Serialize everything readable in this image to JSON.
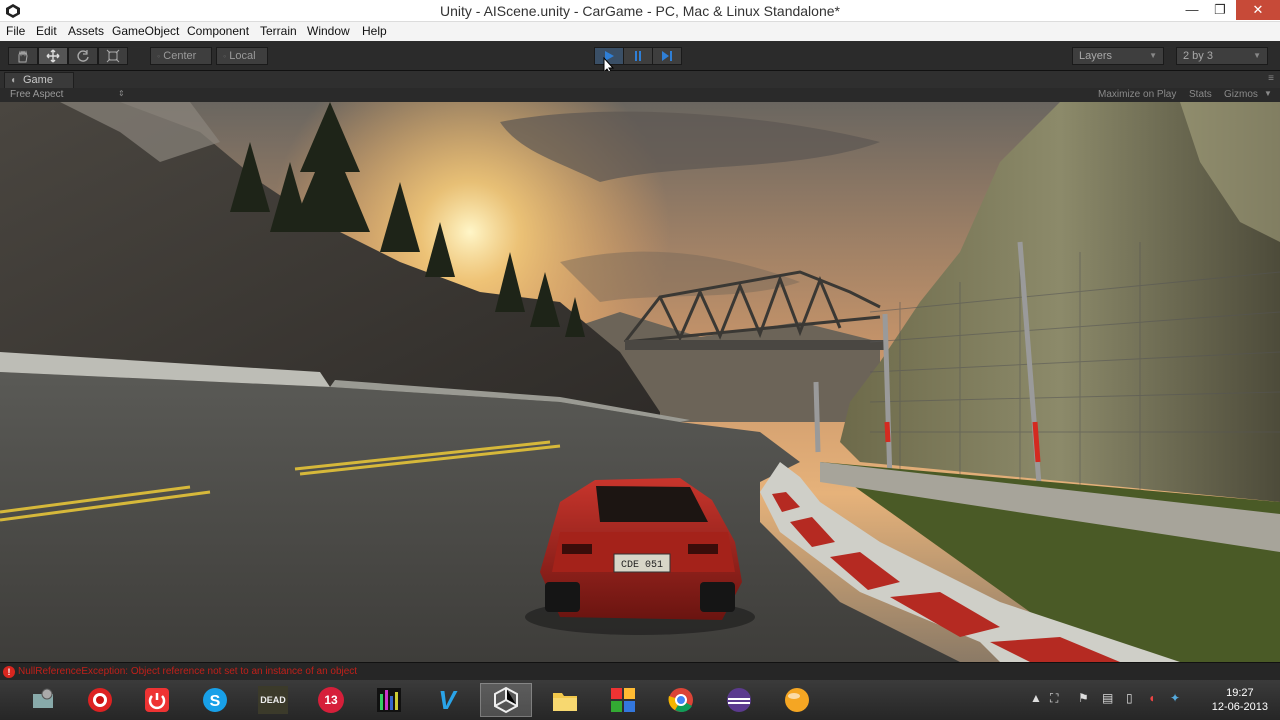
{
  "window": {
    "title": "Unity - AIScene.unity - CarGame - PC, Mac & Linux Standalone*",
    "min_label": "—",
    "max_label": "❐",
    "close_label": "✕"
  },
  "menu": [
    "File",
    "Edit",
    "Assets",
    "GameObject",
    "Component",
    "Terrain",
    "Window",
    "Help"
  ],
  "toolbar": {
    "pivot_center": "Center",
    "pivot_local": "Local",
    "layers": "Layers",
    "layout": "2 by 3"
  },
  "game": {
    "tab_label": "Game",
    "aspect": "Free Aspect",
    "maximize": "Maximize on Play",
    "stats": "Stats",
    "gizmos": "Gizmos",
    "plate": "CDE 051"
  },
  "console": {
    "error_icon": "!",
    "error": "NullReferenceException: Object reference not set to an instance of an object"
  },
  "taskbar": {
    "time": "19:27",
    "date": "12-06-2013",
    "game_badge": "DEAD",
    "num_badge": "13",
    "v_badge": "V"
  },
  "colors": {
    "accent": "#2f7fd6",
    "error": "#c0201a",
    "close": "#c74a38"
  }
}
